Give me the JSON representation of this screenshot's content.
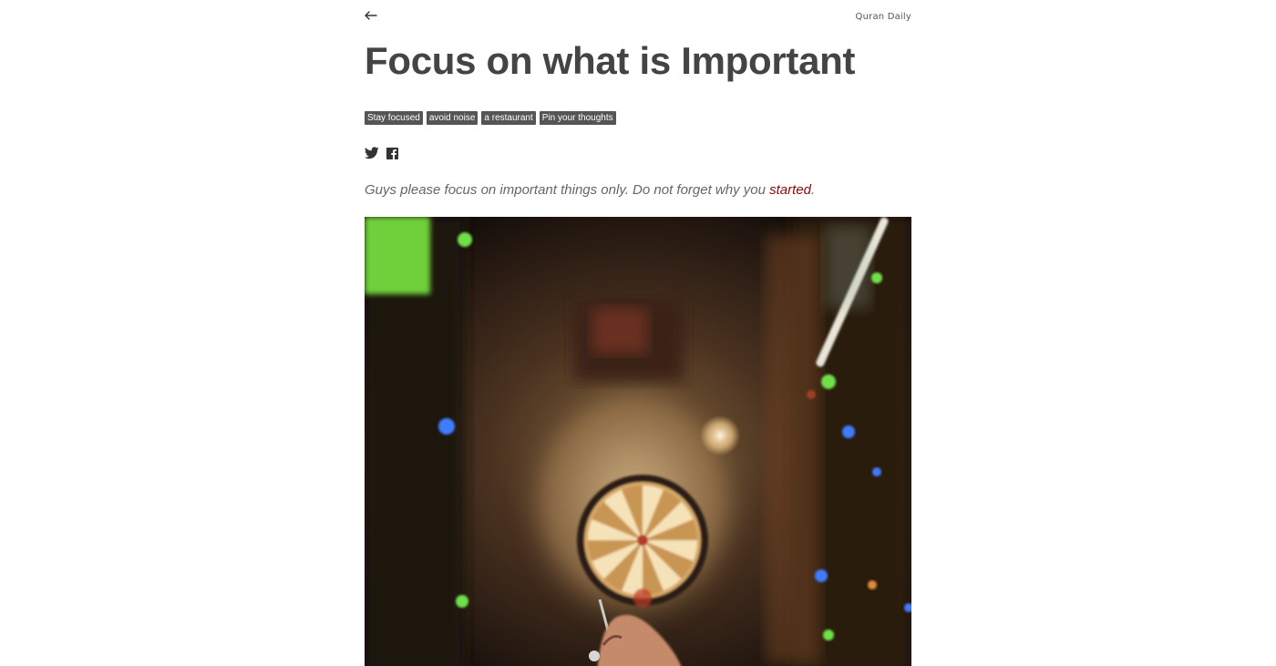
{
  "header": {
    "back_icon": "arrow-left-icon",
    "site_name": "Quran Daily"
  },
  "article": {
    "title": "Focus on what is Important",
    "tags": [
      "Stay focused",
      "avoid noise",
      "a restaurant",
      "Pin your thoughts"
    ],
    "share": {
      "icons": [
        "twitter-icon",
        "facebook-icon"
      ]
    },
    "lead": {
      "text": "Guys please focus on important things only. Do not forget why you ",
      "highlight": "started",
      "end": "."
    },
    "hero_image": {
      "subject": "dartboard-photo",
      "colors": {
        "background": "#1a1310",
        "board_light": "#f3d9a3",
        "board_dark": "#b98a4a",
        "accent_green": "#7ee04f",
        "accent_blue": "#3f7bff"
      }
    }
  },
  "colors": {
    "text": "#444444",
    "tag_bg": "#555555",
    "link": "#8b0a0a"
  }
}
